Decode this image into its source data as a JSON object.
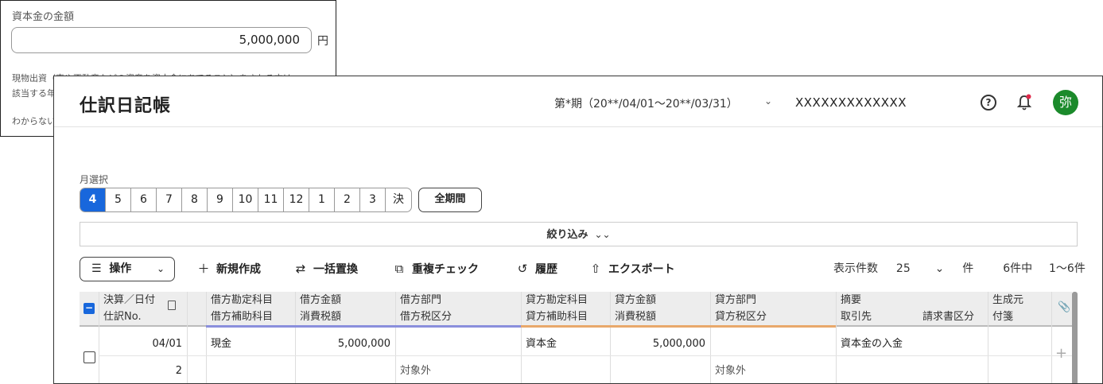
{
  "background_form": {
    "label": "資本金の金額",
    "amount": "5,000,000",
    "unit": "円",
    "note_line1": "現物出資（車や不動産などの資産を資本金にあてること）をされる方は",
    "note_line2": "該当する年",
    "note_line3": "わからない"
  },
  "header": {
    "title": "仕訳日記帳",
    "period": "第*期（20**/04/01〜20**/03/31）",
    "company": "XXXXXXXXXXXXX",
    "help_icon": "?",
    "avatar": "弥"
  },
  "month_selector": {
    "label": "月選択",
    "months": [
      "4",
      "5",
      "6",
      "7",
      "8",
      "9",
      "10",
      "11",
      "12",
      "1",
      "2",
      "3",
      "決"
    ],
    "active": "4",
    "all_period": "全期間"
  },
  "filter": {
    "label": "絞り込み"
  },
  "toolbar": {
    "operation": "操作",
    "new": "新規作成",
    "bulk_replace": "一括置換",
    "duplicate_check": "重複チェック",
    "history": "履歴",
    "export": "エクスポート",
    "page_size_label": "表示件数",
    "page_size": "25",
    "page_size_unit": "件",
    "count": "6件中",
    "range": "1〜6件"
  },
  "table": {
    "headers_top": {
      "date": "決算／日付",
      "debit_account": "借方勘定科目",
      "debit_amount": "借方金額",
      "debit_dept": "借方部門",
      "credit_account": "貸方勘定科目",
      "credit_amount": "貸方金額",
      "credit_dept": "貸方部門",
      "summary": "摘要",
      "source": "生成元"
    },
    "headers_bottom": {
      "date": "仕訳No.",
      "debit_account": "借方補助科目",
      "debit_amount": "消費税額",
      "debit_dept": "借方税区分",
      "credit_account": "貸方補助科目",
      "credit_amount": "消費税額",
      "credit_dept": "貸方税区分",
      "summary": "取引先",
      "invoice": "請求書区分",
      "source": "付箋"
    },
    "rows": [
      {
        "date": "04/01",
        "no": "2",
        "debit_account": "現金",
        "debit_amount": "5,000,000",
        "debit_tax": "対象外",
        "credit_account": "資本金",
        "credit_amount": "5,000,000",
        "credit_tax": "対象外",
        "summary": "資本金の入金"
      }
    ],
    "add_icon": "+"
  },
  "colors": {
    "accent": "#1867dc",
    "debit": "#8a8fdc",
    "credit": "#e8a86b",
    "avatar": "#1b8a2b"
  }
}
